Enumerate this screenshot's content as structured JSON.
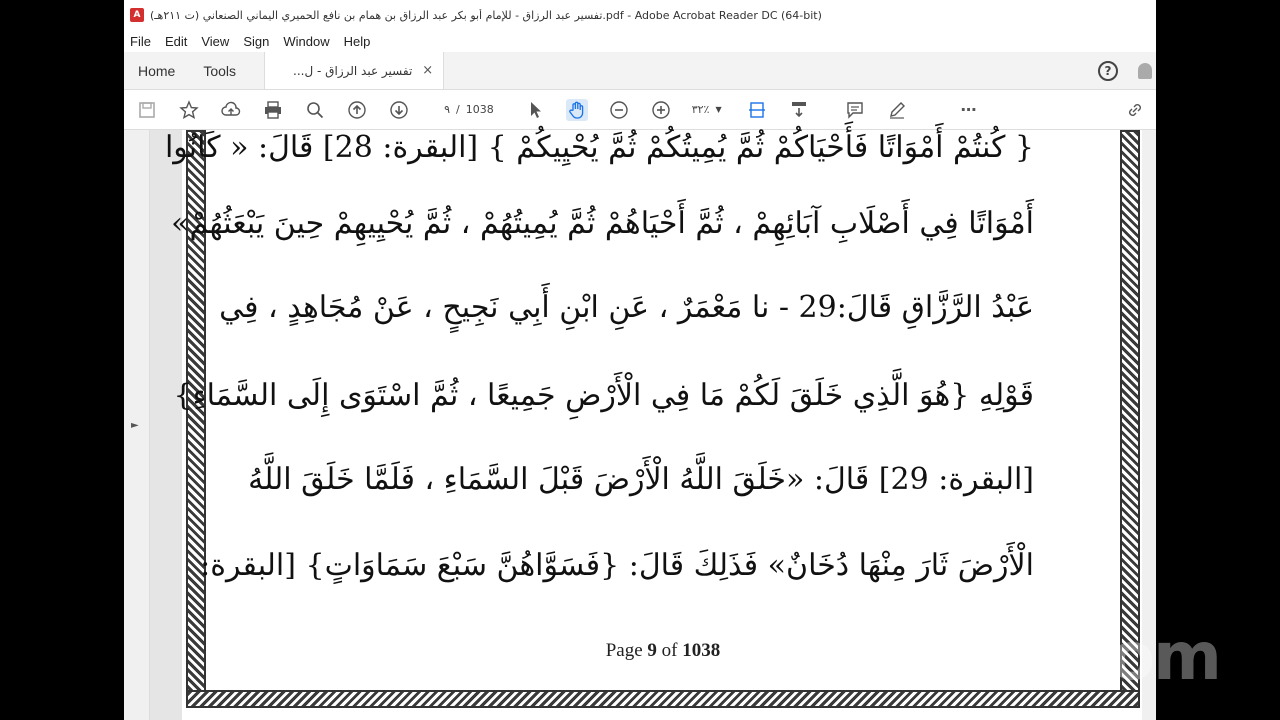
{
  "window": {
    "title": "تفسير عبد الرزاق - للإمام أبو بكر عبد الرزاق بن همام بن نافع الحميري اليماني الصنعاني (ت ٢١١هـ).pdf - Adobe Acrobat Reader DC (64-bit)"
  },
  "menu": [
    "File",
    "Edit",
    "View",
    "Sign",
    "Window",
    "Help"
  ],
  "tabs": {
    "home": "Home",
    "tools": "Tools",
    "document": "تفسير عبد الرزاق - ل...",
    "close": "×"
  },
  "toolbar": {
    "page_current": "٩",
    "page_separator": "/",
    "page_total": "1038",
    "zoom": "٣٢٪"
  },
  "document": {
    "lines": [
      "{ كُنتُمْ أَمْوَاتًا فَأَحْيَاكُمْ ثُمَّ يُمِيتُكُمْ ثُمَّ يُحْيِيكُمْ } [البقرة: 28] قَالَ: « كَانُوا",
      "أَمْوَاتًا فِي أَصْلَابِ آبَائِهِمْ ، ثُمَّ أَحْيَاهُمْ ثُمَّ يُمِيتُهُمْ ، ثُمَّ يُحْيِيهِمْ حِينَ يَبْعَثُهُمْ»",
      "عَبْدُ الرَّزَّاقِ قَالَ:29 - نا مَعْمَرٌ ، عَنِ ابْنِ أَبِي نَجِيحٍ ، عَنْ مُجَاهِدٍ ، فِي",
      "قَوْلِهِ {هُوَ الَّذِي خَلَقَ لَكُمْ مَا فِي الْأَرْضِ جَمِيعًا ، ثُمَّ اسْتَوَى إِلَى السَّمَاءِ}",
      "[البقرة: 29] قَالَ: «خَلَقَ اللَّهُ الْأَرْضَ قَبْلَ السَّمَاءِ ، فَلَمَّا خَلَقَ اللَّهُ",
      "الْأَرْضَ ثَارَ مِنْهَا دُخَانٌ» فَذَلِكَ قَالَ: {فَسَوَّاهُنَّ سَبْعَ سَمَاوَاتٍ} [البقرة:"
    ],
    "page_label_prefix": "Page",
    "page_number": "9",
    "page_label_of": "of",
    "page_total": "1038"
  },
  "overlay": {
    "watermark": "zoom"
  }
}
